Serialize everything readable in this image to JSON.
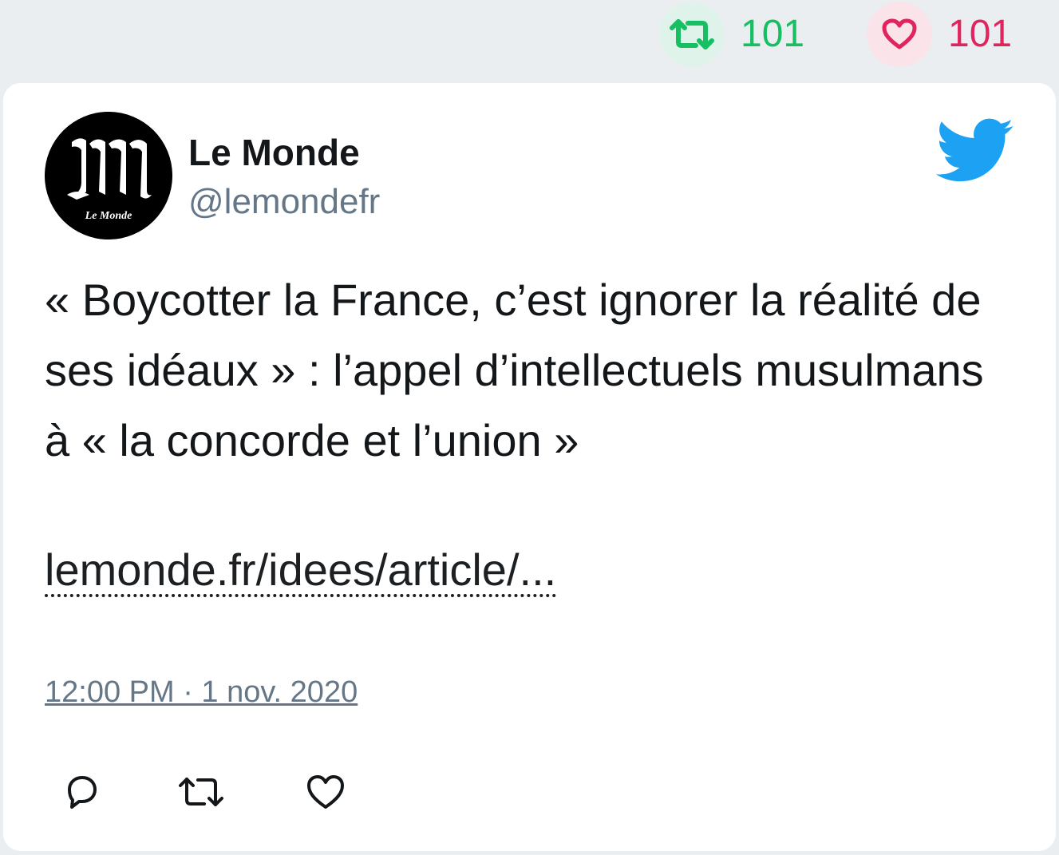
{
  "stats": {
    "retweet_icon": "retweet-icon",
    "retweet_count": "101",
    "retweet_color": "#17bf63",
    "like_icon": "heart-icon",
    "like_count": "101",
    "like_color": "#e0245e"
  },
  "tweet": {
    "author_name": "Le Monde",
    "author_handle": "@lemondefr",
    "avatar_icon": "le-monde-logo",
    "platform_icon": "twitter-bird-icon",
    "platform_color": "#1da1f2",
    "text": "« Boycotter la France, c’est ignorer la réalité de ses idéaux » : l’appel d’intellectuels musulmans à « la concorde et l’union »",
    "link": "lemonde.fr/idees/article/...",
    "timestamp": "12:00 PM · 1 nov. 2020"
  },
  "actions": [
    {
      "icon": "reply-icon"
    },
    {
      "icon": "retweet-icon"
    },
    {
      "icon": "heart-icon"
    }
  ]
}
